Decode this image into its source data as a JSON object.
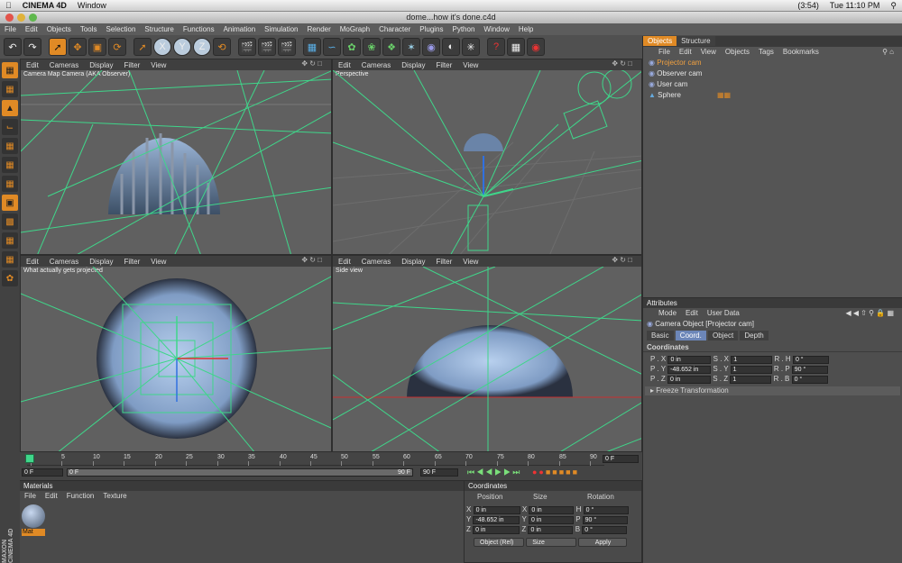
{
  "macmenu": {
    "apple": "",
    "app": "CINEMA 4D",
    "window": "Window",
    "battery": "(3:54)",
    "time": "Tue 11:10 PM"
  },
  "window_title": "dome...how it's done.c4d",
  "main_menu": [
    "File",
    "Edit",
    "Objects",
    "Tools",
    "Selection",
    "Structure",
    "Functions",
    "Animation",
    "Simulation",
    "Render",
    "MoGraph",
    "Character",
    "Plugins",
    "Python",
    "Window",
    "Help"
  ],
  "viewport_menu": [
    "Edit",
    "Cameras",
    "Display",
    "Filter",
    "View"
  ],
  "viewports": {
    "tl": {
      "title": "Camera Map Camera (AKA Observer)"
    },
    "tr": {
      "title": "Perspective"
    },
    "bl": {
      "title": "What actually gets projected"
    },
    "br": {
      "title": "Side view"
    }
  },
  "timeline": {
    "ticks": [
      "0",
      "5",
      "10",
      "15",
      "20",
      "25",
      "30",
      "35",
      "40",
      "45",
      "50",
      "55",
      "60",
      "65",
      "70",
      "75",
      "80",
      "85",
      "90"
    ],
    "current": "0 F",
    "start": "0 F",
    "range_start": "0 F",
    "range_end": "90 F",
    "end": "90 F",
    "frame_field": "0 F"
  },
  "materials": {
    "header": "Materials",
    "menu": [
      "File",
      "Edit",
      "Function",
      "Texture"
    ],
    "mat_label": "Mat"
  },
  "coords": {
    "header": "Coordinates",
    "cols": [
      "Position",
      "Size",
      "Rotation"
    ],
    "rows": [
      {
        "axis": "X",
        "pos": "0 in",
        "saxis": "X",
        "size": "0 in",
        "raxis": "H",
        "rot": "0 °"
      },
      {
        "axis": "Y",
        "pos": "-48.652 in",
        "saxis": "Y",
        "size": "0 in",
        "raxis": "P",
        "rot": "90 °"
      },
      {
        "axis": "Z",
        "pos": "0 in",
        "saxis": "Z",
        "size": "0 in",
        "raxis": "B",
        "rot": "0 °"
      }
    ],
    "mode": "Object (Rel)",
    "sizemode": "Size",
    "apply": "Apply"
  },
  "objects": {
    "tabs": [
      "Objects",
      "Structure"
    ],
    "menu": [
      "File",
      "Edit",
      "View",
      "Objects",
      "Tags",
      "Bookmarks"
    ],
    "items": [
      "Projector cam",
      "Observer cam",
      "User cam",
      "Sphere"
    ]
  },
  "attributes": {
    "header": "Attributes",
    "menu": [
      "Mode",
      "Edit",
      "User Data"
    ],
    "object": "Camera Object [Projector cam]",
    "tabs": [
      "Basic",
      "Coord.",
      "Object",
      "Depth"
    ],
    "section": "Coordinates",
    "rows": [
      {
        "p": "P . X",
        "pv": "0 in",
        "s": "S . X",
        "sv": "1",
        "r": "R . H",
        "rv": "0 °"
      },
      {
        "p": "P . Y",
        "pv": "-48.652 in",
        "s": "S . Y",
        "sv": "1",
        "r": "R . P",
        "rv": "90 °"
      },
      {
        "p": "P . Z",
        "pv": "0 in",
        "s": "S . Z",
        "sv": "1",
        "r": "R . B",
        "rv": "0 °"
      }
    ],
    "freeze": "Freeze Transformation"
  },
  "branding": "MAXON CINEMA 4D",
  "colors": {
    "accent": "#e08a25",
    "guide": "#3fd68a"
  }
}
